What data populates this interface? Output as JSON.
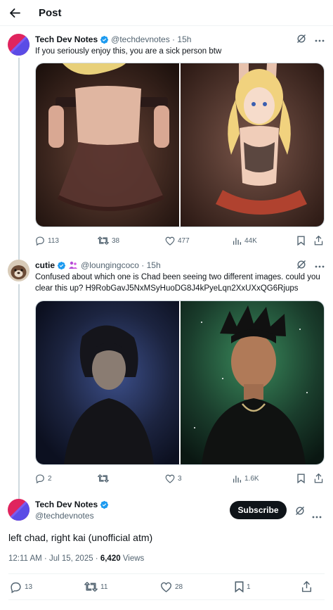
{
  "header": {
    "title": "Post"
  },
  "tweet1": {
    "name": "Tech Dev Notes",
    "handle": "@techdevnotes",
    "time": "15h",
    "text": "If you seriously enjoy this, you are a sick person btw",
    "replies": "113",
    "reposts": "38",
    "likes": "477",
    "views": "44K"
  },
  "tweet2": {
    "name": "cutie",
    "handle": "@loungingcoco",
    "time": "15h",
    "text": "Confused about which one is Chad been seeing two different images. could you clear this up? H9RobGavJ5NxMSyHuoDG8J4kPyeLqn2XxUXxQG6Rjups",
    "replies": "2",
    "reposts": "",
    "likes": "3",
    "views": "1.6K"
  },
  "main_post": {
    "name": "Tech Dev Notes",
    "handle": "@techdevnotes",
    "subscribe_label": "Subscribe",
    "text": "left chad, right kai (unofficial atm)",
    "date": "12:11 AM · Jul 15, 2025 · ",
    "views_count": "6,420",
    "views_label": " Views",
    "replies": "13",
    "reposts": "11",
    "likes": "28",
    "bookmarks": "1"
  },
  "colors": {
    "verified": "#1d9bf0",
    "text_secondary": "#536471",
    "border": "#eff3f4",
    "button_dark": "#0f1419"
  }
}
